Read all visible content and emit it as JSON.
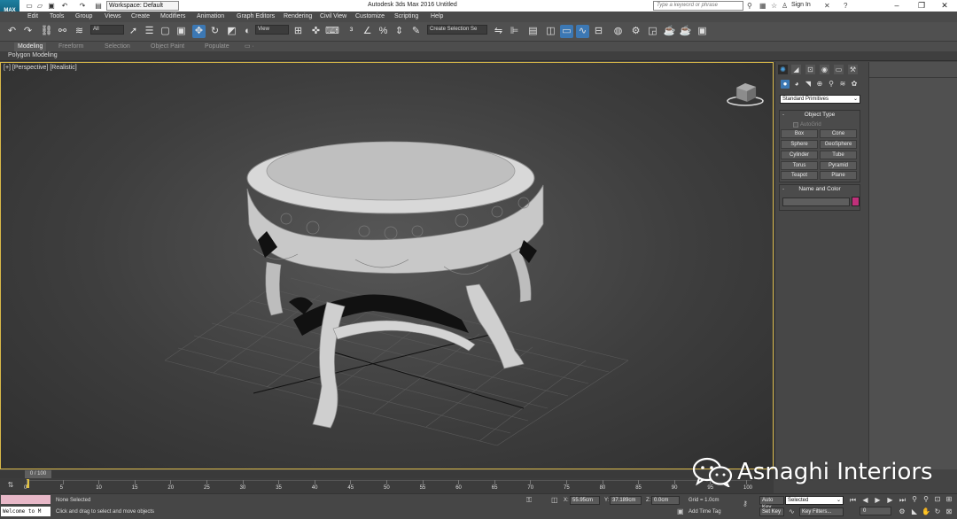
{
  "titlebar": {
    "workspace": "Workspace: Default",
    "window_title": "Autodesk 3ds Max 2016      Untitled",
    "search_placeholder": "Type a keyword or phrase",
    "sign_in": "Sign In"
  },
  "menus": [
    "Edit",
    "Tools",
    "Group",
    "Views",
    "Create",
    "Modifiers",
    "Animation",
    "Graph Editors",
    "Rendering",
    "Civil View",
    "Customize",
    "Scripting",
    "Help"
  ],
  "toolbar": {
    "selection_filter": "All",
    "reference_coord": "View",
    "named_selection": "Create Selection Se"
  },
  "ribbon": {
    "tabs": [
      "Modeling",
      "Freeform",
      "Selection",
      "Object Paint",
      "Populate"
    ],
    "active_tab": "Modeling",
    "sub_label": "Polygon Modeling"
  },
  "viewport": {
    "label": "[+] [Perspective] [Realistic]"
  },
  "command_panel": {
    "category": "Standard Primitives",
    "object_type_title": "Object Type",
    "autogrid_label": "AutoGrid",
    "object_buttons": [
      "Box",
      "Cone",
      "Sphere",
      "GeoSphere",
      "Cylinder",
      "Tube",
      "Torus",
      "Pyramid",
      "Teapot",
      "Plane"
    ],
    "name_color_title": "Name and Color",
    "object_color": "#c0307a"
  },
  "timeline": {
    "slider_label": "0 / 100",
    "ticks": [
      "0",
      "5",
      "10",
      "15",
      "20",
      "25",
      "30",
      "35",
      "40",
      "45",
      "50",
      "55",
      "60",
      "65",
      "70",
      "75",
      "80",
      "85",
      "90",
      "95",
      "100"
    ]
  },
  "statusbar": {
    "maxscript_text": "Welcome to M",
    "selection_status": "None Selected",
    "prompt": "Click and drag to select and move objects",
    "x_label": "X:",
    "x_value": "55.95cm",
    "y_label": "Y:",
    "y_value": "37.189cm",
    "z_label": "Z:",
    "z_value": "0.0cm",
    "grid": "Grid = 1.0cm",
    "add_time_tag": "Add Time Tag",
    "auto_key": "Auto Key",
    "set_key": "Set Key",
    "selected": "Selected",
    "key_filters": "Key Filters...",
    "current_frame": "0"
  },
  "watermark": {
    "text": "Asnaghi Interiors"
  }
}
